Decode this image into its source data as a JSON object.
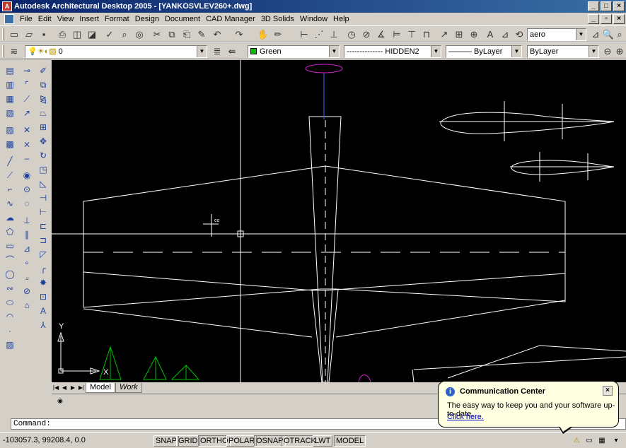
{
  "window": {
    "title": "Autodesk Architectural Desktop 2005 - [YANKOSVLEV260+.dwg]",
    "controls": [
      "_",
      "□",
      "×"
    ],
    "doc_controls": [
      "_",
      "▫",
      "×"
    ]
  },
  "menu": {
    "items": [
      "File",
      "Edit",
      "View",
      "Insert",
      "Format",
      "Design",
      "Document",
      "CAD Manager",
      "3D Solids",
      "Window",
      "Help"
    ]
  },
  "toolbar1": {
    "text_style_value": "aero"
  },
  "toolbar2": {
    "layer_value": "0",
    "color_value": "Green",
    "color_hex": "#00c000",
    "linetype_value": "-------------- HIDDEN2",
    "lineweight_value": "——— ByLayer",
    "plotstyle_value": "ByLayer"
  },
  "drawing": {
    "background": "#000000",
    "dimension_text": "co",
    "ucs": {
      "x_label": "X",
      "y_label": "Y"
    }
  },
  "tabs": {
    "items": [
      "Model",
      "Work"
    ],
    "active": "Model"
  },
  "command": {
    "prompt": "Command:"
  },
  "status": {
    "coordinates": "-103057.3, 99208.4, 0.0",
    "buttons": [
      {
        "label": "SNAP",
        "pressed": false
      },
      {
        "label": "GRID",
        "pressed": false
      },
      {
        "label": "ORTHO",
        "pressed": true
      },
      {
        "label": "POLAR",
        "pressed": false
      },
      {
        "label": "OSNAP",
        "pressed": true
      },
      {
        "label": "OTRACK",
        "pressed": true
      },
      {
        "label": "LWT",
        "pressed": false
      },
      {
        "label": "MODEL",
        "pressed": true
      }
    ]
  },
  "communication_center": {
    "title": "Communication Center",
    "body": "The easy way to keep you and your software up-to-date.",
    "link": "Click here."
  }
}
